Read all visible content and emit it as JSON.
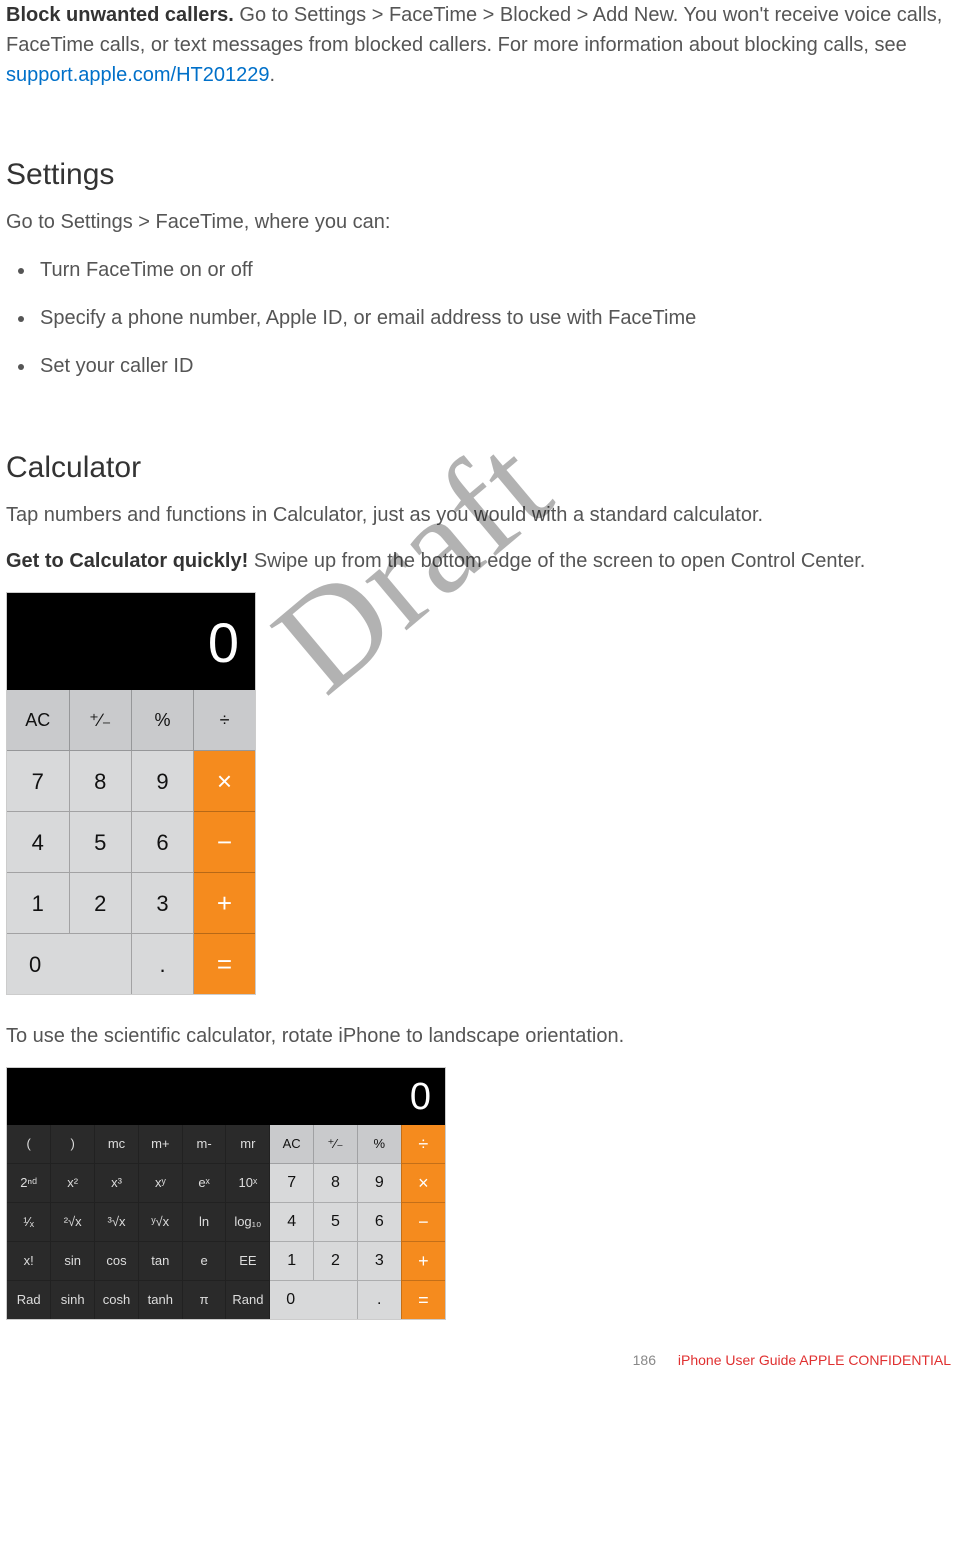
{
  "watermark": "Draft",
  "intro": {
    "bold": "Block unwanted callers. ",
    "text1": "Go to Settings > FaceTime > Blocked > Add New. You won't receive voice calls, FaceTime calls, or text messages from blocked callers. For more information about blocking calls, see ",
    "link": "support.apple.com/HT201229",
    "period": "."
  },
  "settings": {
    "heading": "Settings",
    "lead": "Go to Settings > FaceTime, where you can:",
    "bullets": [
      "Turn FaceTime on or off",
      "Specify a phone number, Apple ID, or email address to use with FaceTime",
      "Set your caller ID"
    ]
  },
  "calculator": {
    "heading": "Calculator",
    "p1": "Tap numbers and functions in Calculator, just as you would with a standard calculator.",
    "tip_bold": "Get to Calculator quickly! ",
    "tip_rest": "Swipe up from the bottom edge of the screen to open Control Center.",
    "p2": "To use the scientific calculator, rotate iPhone to landscape orientation."
  },
  "calc_portrait": {
    "display": "0",
    "rows": [
      {
        "type": "func",
        "cells": [
          "AC",
          "⁺∕₋",
          "%"
        ],
        "op": "÷"
      },
      {
        "type": "num",
        "cells": [
          "7",
          "8",
          "9"
        ],
        "op": "×"
      },
      {
        "type": "num",
        "cells": [
          "4",
          "5",
          "6"
        ],
        "op": "−"
      },
      {
        "type": "num",
        "cells": [
          "1",
          "2",
          "3"
        ],
        "op": "+"
      },
      {
        "type": "bottom",
        "zero": "0",
        "dot": ".",
        "op": "="
      }
    ]
  },
  "calc_landscape": {
    "display": "0",
    "rows": [
      [
        "(",
        ")",
        "mc",
        "m+",
        "m-",
        "mr",
        "AC",
        "⁺∕₋",
        "%",
        "÷"
      ],
      [
        "2ⁿᵈ",
        "x²",
        "x³",
        "xʸ",
        "eˣ",
        "10ˣ",
        "7",
        "8",
        "9",
        "×"
      ],
      [
        "¹⁄ₓ",
        "²√x",
        "³√x",
        "ʸ√x",
        "ln",
        "log₁₀",
        "4",
        "5",
        "6",
        "−"
      ],
      [
        "x!",
        "sin",
        "cos",
        "tan",
        "e",
        "EE",
        "1",
        "2",
        "3",
        "+"
      ],
      [
        "Rad",
        "sinh",
        "cosh",
        "tanh",
        "π",
        "Rand",
        "0",
        "",
        ".",
        "="
      ]
    ]
  },
  "footer": {
    "page": "186",
    "title": "iPhone User Guide  APPLE CONFIDENTIAL"
  }
}
